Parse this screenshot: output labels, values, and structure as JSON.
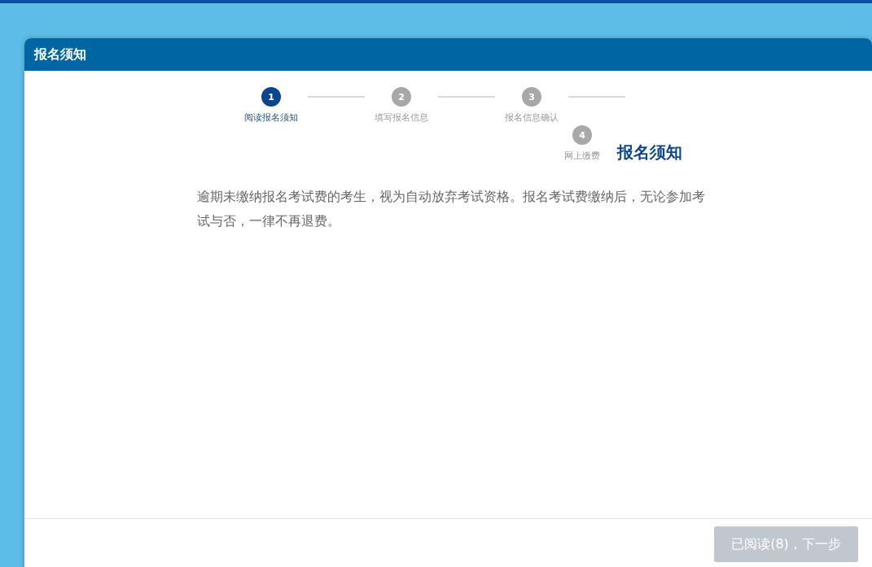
{
  "dialog": {
    "title": "报名须知"
  },
  "steps": [
    {
      "number": "1",
      "label": "阅读报名须知",
      "selected": true
    },
    {
      "number": "2",
      "label": "填写报名信息",
      "selected": false
    },
    {
      "number": "3",
      "label": "报名信息确认",
      "selected": false
    },
    {
      "number": "4",
      "label": "网上缴费",
      "selected": false
    }
  ],
  "section_title": "报名须知",
  "notice": "逾期未缴纳报名考试费的考生，视为自动放弃考试资格。报名考试费缴纳后，无论参加考试与否，一律不再退费。",
  "next_button": {
    "label": "已阅读(8)，下一步",
    "disabled": true
  }
}
